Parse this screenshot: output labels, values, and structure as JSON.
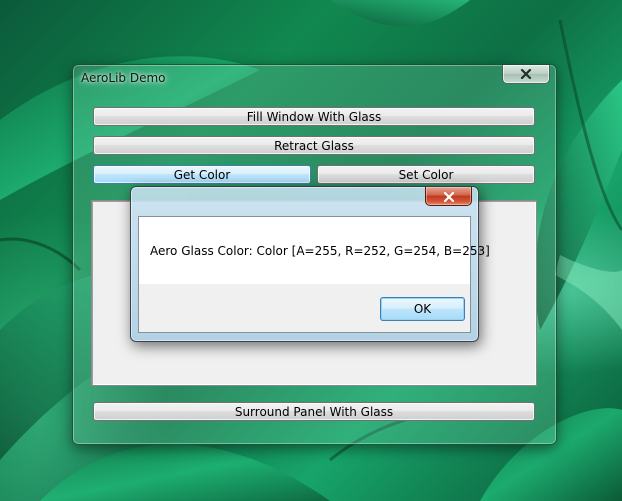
{
  "desktop": {
    "wallpaper": "green leaves"
  },
  "main_window": {
    "title": "AeroLib Demo",
    "close_icon": "close-icon",
    "buttons": {
      "fill_glass": "Fill Window With Glass",
      "retract_glass": "Retract Glass",
      "get_color": "Get Color",
      "set_color": "Set Color",
      "surround_panel": "Surround Panel With Glass"
    }
  },
  "message_box": {
    "message": "Aero Glass Color: Color [A=255, R=252, G=254, B=253]",
    "ok_label": "OK",
    "close_icon": "close-icon"
  },
  "colors": {
    "close_button_red": "#c2391b",
    "focus_blue": "#3c7fb1",
    "glass_green": "#78d2aa"
  }
}
